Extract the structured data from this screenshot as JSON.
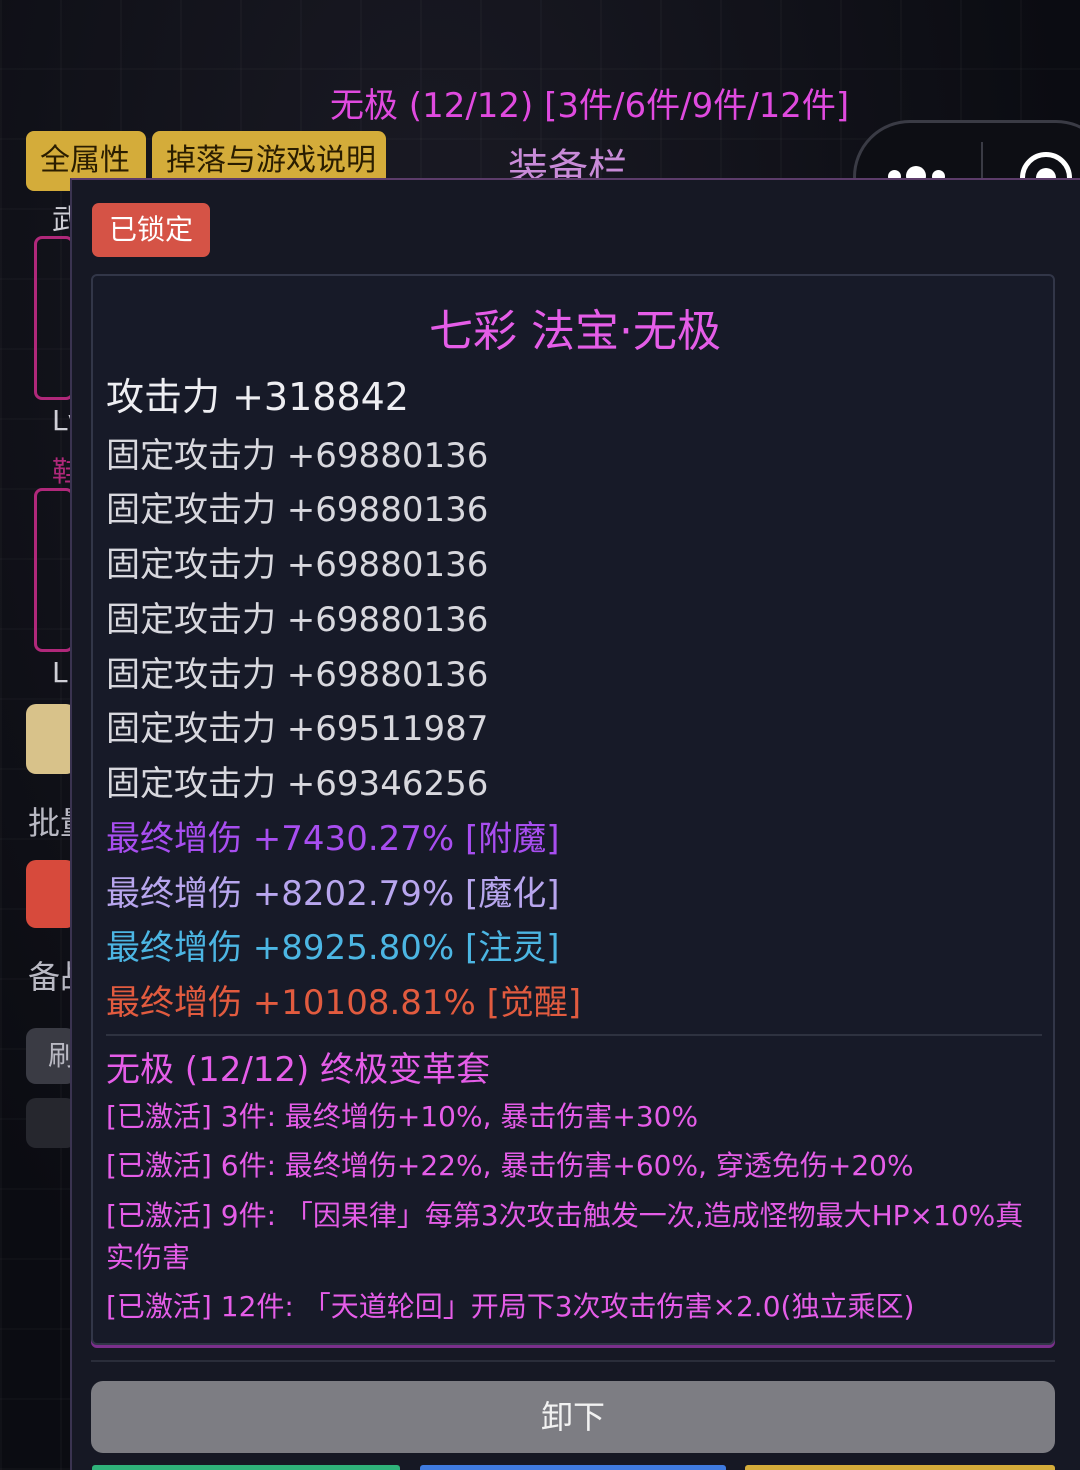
{
  "header": {
    "set_progress_title": "无极 (12/12) [3件/6件/9件/12件]",
    "equip_title": "装备栏",
    "buttons": {
      "all_attributes": "全属性",
      "drops_and_guide": "掉落与游戏说明"
    },
    "capsule": {
      "menu_icon": "more-dots-icon",
      "close_icon": "target-circle-icon"
    }
  },
  "sidebar": {
    "fragments": [
      "武",
      "Lv",
      "鞋",
      "L",
      "批量",
      "备战",
      "刷"
    ]
  },
  "item": {
    "lock_label": "已锁定",
    "name": "七彩 法宝·无极",
    "main_stat": "攻击力 +318842",
    "fixed_stats": [
      "固定攻击力 +69880136",
      "固定攻击力 +69880136",
      "固定攻击力 +69880136",
      "固定攻击力 +69880136",
      "固定攻击力 +69880136",
      "固定攻击力 +69511987",
      "固定攻击力 +69346256"
    ],
    "bonus_stats": [
      {
        "text": "最终增伤 +7430.27% [附魔]",
        "color": "#a84ef0"
      },
      {
        "text": "最终增伤 +8202.79% [魔化]",
        "color": "#b8a6ee"
      },
      {
        "text": "最终增伤 +8925.80% [注灵]",
        "color": "#4cb6e3"
      },
      {
        "text": "最终增伤 +10108.81% [觉醒]",
        "color": "#e25b3f"
      }
    ],
    "set": {
      "title": "无极 (12/12)  终极变革套",
      "effects": [
        "[已激活] 3件: 最终增伤+10%, 暴击伤害+30%",
        "[已激活] 6件: 最终增伤+22%, 暴击伤害+60%, 穿透免伤+20%",
        "[已激活] 9件: 「因果律」每第3次攻击触发一次,造成怪物最大HP×10%真实伤害",
        "[已激活] 12件: 「天道轮回」开局下3次攻击伤害×2.0(独立乘区)"
      ]
    }
  },
  "actions": {
    "unload": "卸下"
  },
  "colors": {
    "accent_pink": "#e55de8",
    "lock_red": "#d55346",
    "gold_button": "#d4ac3a"
  }
}
